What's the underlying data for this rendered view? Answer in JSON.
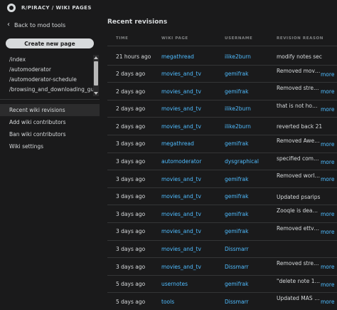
{
  "breadcrumb": "R/PIRACY / WIKI PAGES",
  "sidebar": {
    "back_label": "Back to mod tools",
    "create_button": "Create new page",
    "pages": [
      "/index",
      "/automoderator",
      "/automoderator-schedule",
      "/browsing_and_downloading_guide"
    ],
    "nav": [
      {
        "label": "Recent wiki revisions",
        "active": true
      },
      {
        "label": "Add wiki contributors",
        "active": false
      },
      {
        "label": "Ban wiki contributors",
        "active": false
      },
      {
        "label": "Wiki settings",
        "active": false
      }
    ]
  },
  "main": {
    "heading": "Recent revisions",
    "columns": [
      "TIME",
      "WIKI PAGE",
      "USERNAME",
      "REVISION REASON"
    ],
    "more_label": "more",
    "rows": [
      {
        "time": "21 hours ago",
        "page": "megathread",
        "user": "ilike2burn",
        "reason": "modify notes section",
        "more": false
      },
      {
        "time": "2 days ago",
        "page": "movies_and_tv",
        "user": "gemifrak",
        "reason": "Removed moviet...",
        "more": true
      },
      {
        "time": "2 days ago",
        "page": "movies_and_tv",
        "user": "gemifrak",
        "reason": "Removed strea...",
        "more": true
      },
      {
        "time": "2 days ago",
        "page": "movies_and_tv",
        "user": "ilike2burn",
        "reason": "that is not how t...",
        "more": true
      },
      {
        "time": "2 days ago",
        "page": "movies_and_tv",
        "user": "ilike2burn",
        "reason": "reverted back 21 hours",
        "more": false
      },
      {
        "time": "3 days ago",
        "page": "megathread",
        "user": "gemifrak",
        "reason": "Removed Aweso...",
        "more": true
      },
      {
        "time": "3 days ago",
        "page": "automoderator",
        "user": "dysgraphical",
        "reason": "specified comm...",
        "more": true
      },
      {
        "time": "3 days ago",
        "page": "movies_and_tv",
        "user": "gemifrak",
        "reason": "Removed worldc...",
        "more": true
      },
      {
        "time": "3 days ago",
        "page": "movies_and_tv",
        "user": "gemifrak",
        "reason": "Updated psarips link",
        "more": false
      },
      {
        "time": "3 days ago",
        "page": "movies_and_tv",
        "user": "gemifrak",
        "reason": "Zooqle is dead. ...",
        "more": true
      },
      {
        "time": "3 days ago",
        "page": "movies_and_tv",
        "user": "gemifrak",
        "reason": "Removed ettvdl....",
        "more": true
      },
      {
        "time": "3 days ago",
        "page": "movies_and_tv",
        "user": "Dissmarr",
        "reason": "",
        "more": false
      },
      {
        "time": "3 days ago",
        "page": "movies_and_tv",
        "user": "Dissmarr",
        "reason": "Removed strea...",
        "more": true
      },
      {
        "time": "5 days ago",
        "page": "usernotes",
        "user": "gemifrak",
        "reason": "\"delete note 157...",
        "more": true
      },
      {
        "time": "5 days ago",
        "page": "tools",
        "user": "Dissmarr",
        "reason": "Updated MAS ve...",
        "more": true
      }
    ]
  }
}
